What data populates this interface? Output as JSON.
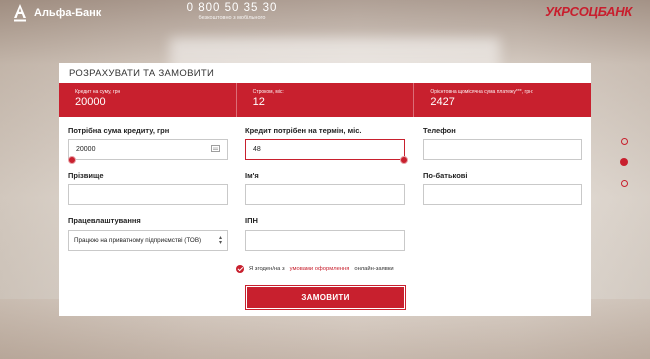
{
  "header": {
    "brand_left": "Альфа-Банк",
    "phone": "0 800 50 35 30",
    "phone_caption": "безкоштовно з мобільного",
    "brand_right": "УКРСОЦБАНК"
  },
  "form": {
    "title": "РОЗРАХУВАТИ ТА ЗАМОВИТИ",
    "summary": [
      {
        "label": "Кредит на суму, грн",
        "value": "20000"
      },
      {
        "label": "Строком, міс:",
        "value": "12"
      },
      {
        "label": "Орієнтовна щомісячна сума платежу***, грн:",
        "value": "2427"
      }
    ],
    "fields": {
      "amount": {
        "label": "Потрібна сума кредиту, грн",
        "value": "20000"
      },
      "term": {
        "label": "Кредит потрібен на термін, міс.",
        "value": "48"
      },
      "phone": {
        "label": "Телефон",
        "value": ""
      },
      "surname": {
        "label": "Прізвище",
        "value": ""
      },
      "name": {
        "label": "Ім'я",
        "value": ""
      },
      "patronymic": {
        "label": "По-батькові",
        "value": ""
      },
      "employment": {
        "label": "Працевлаштування",
        "value": "Працюю на приватному підприємстві (ТОВ)"
      },
      "tax_id": {
        "label": "ІПН",
        "value": ""
      }
    },
    "agreement": {
      "prefix": "Я згоден/на з",
      "link": "умовами оформлення",
      "suffix": "онлайн-заявки"
    },
    "submit_label": "ЗАМОВИТИ"
  },
  "pager": {
    "count": 3,
    "active": 1
  },
  "colors": {
    "accent": "#c8202e",
    "border": "#c9c9c9"
  }
}
